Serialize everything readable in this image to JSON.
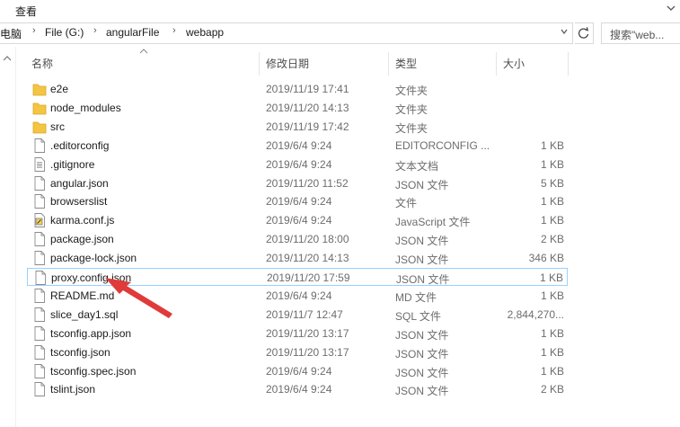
{
  "ribbon": {
    "view_label": "查看"
  },
  "address": {
    "crumbs": [
      "电脑",
      "File (G:)",
      "angularFile",
      "webapp"
    ],
    "separator": "›"
  },
  "search": {
    "placeholder": "搜索\"web..."
  },
  "columns": {
    "name": "名称",
    "date": "修改日期",
    "type": "类型",
    "size": "大小"
  },
  "files": [
    {
      "name": "e2e",
      "date": "2019/11/19 17:41",
      "type": "文件夹",
      "size": "",
      "icon": "folder-icon"
    },
    {
      "name": "node_modules",
      "date": "2019/11/20 14:13",
      "type": "文件夹",
      "size": "",
      "icon": "folder-icon"
    },
    {
      "name": "src",
      "date": "2019/11/19 17:42",
      "type": "文件夹",
      "size": "",
      "icon": "folder-icon"
    },
    {
      "name": ".editorconfig",
      "date": "2019/6/4 9:24",
      "type": "EDITORCONFIG ...",
      "size": "1 KB",
      "icon": "file-icon"
    },
    {
      "name": ".gitignore",
      "date": "2019/6/4 9:24",
      "type": "文本文档",
      "size": "1 KB",
      "icon": "text-file-icon"
    },
    {
      "name": "angular.json",
      "date": "2019/11/20 11:52",
      "type": "JSON 文件",
      "size": "5 KB",
      "icon": "file-icon"
    },
    {
      "name": "browserslist",
      "date": "2019/6/4 9:24",
      "type": "文件",
      "size": "1 KB",
      "icon": "file-icon"
    },
    {
      "name": "karma.conf.js",
      "date": "2019/6/4 9:24",
      "type": "JavaScript 文件",
      "size": "1 KB",
      "icon": "script-file-icon"
    },
    {
      "name": "package.json",
      "date": "2019/11/20 18:00",
      "type": "JSON 文件",
      "size": "2 KB",
      "icon": "file-icon"
    },
    {
      "name": "package-lock.json",
      "date": "2019/11/20 14:13",
      "type": "JSON 文件",
      "size": "346 KB",
      "icon": "file-icon"
    },
    {
      "name": "proxy.config.json",
      "date": "2019/11/20 17:59",
      "type": "JSON 文件",
      "size": "1 KB",
      "icon": "file-icon",
      "selected": true
    },
    {
      "name": "README.md",
      "date": "2019/6/4 9:24",
      "type": "MD 文件",
      "size": "1 KB",
      "icon": "file-icon"
    },
    {
      "name": "slice_day1.sql",
      "date": "2019/11/7 12:47",
      "type": "SQL 文件",
      "size": "2,844,270...",
      "icon": "file-icon"
    },
    {
      "name": "tsconfig.app.json",
      "date": "2019/11/20 13:17",
      "type": "JSON 文件",
      "size": "1 KB",
      "icon": "file-icon"
    },
    {
      "name": "tsconfig.json",
      "date": "2019/11/20 13:17",
      "type": "JSON 文件",
      "size": "1 KB",
      "icon": "file-icon"
    },
    {
      "name": "tsconfig.spec.json",
      "date": "2019/6/4 9:24",
      "type": "JSON 文件",
      "size": "1 KB",
      "icon": "file-icon"
    },
    {
      "name": "tslint.json",
      "date": "2019/6/4 9:24",
      "type": "JSON 文件",
      "size": "2 KB",
      "icon": "file-icon"
    }
  ],
  "colors": {
    "folder": "#f4c542",
    "selection_border": "#99d1ff",
    "annotation_arrow": "#e03a3a"
  }
}
